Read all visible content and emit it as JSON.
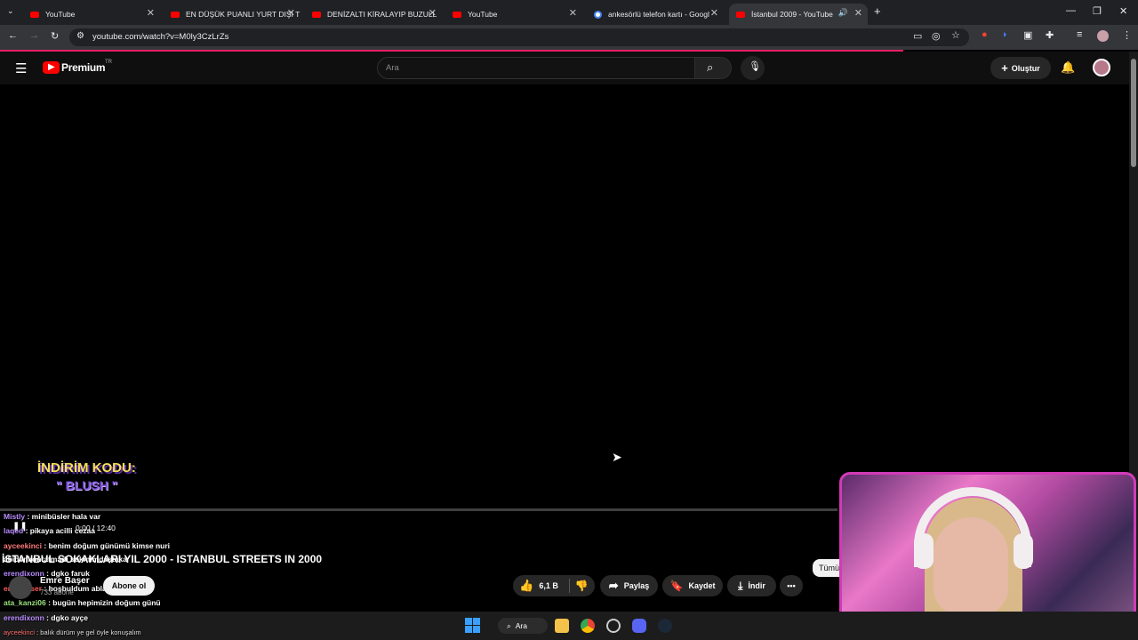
{
  "browser": {
    "tabs": [
      {
        "label": "YouTube"
      },
      {
        "label": "EN DÜŞÜK PUANLI YURT DIŞI T"
      },
      {
        "label": "DENİZALTI KİRALAYIP BUZULL"
      },
      {
        "label": "YouTube"
      },
      {
        "label": "ankesörlü telefon kartı - Googl"
      },
      {
        "label": "İstanbul 2009 - YouTube"
      }
    ],
    "url": "youtube.com/watch?v=M0ly3CzLrZs",
    "new_tab": "+"
  },
  "youtube": {
    "logo": "Premium",
    "region": "TR",
    "search_placeholder": "Ara",
    "create_label": "Oluştur"
  },
  "overlay": {
    "promo_line1": "İNDİRİM KODU:",
    "promo_line2": "\" BLUSH \"",
    "time": "0:00 / 12:40"
  },
  "chat": [
    {
      "user": "Mistly",
      "msg": " : minibüsler hala var"
    },
    {
      "user": "laqed",
      "msg": " : pikaya acilli cezaa"
    },
    {
      "user": "ayceekinci",
      "msg": " : benim doğum günümü kimse nuri"
    },
    {
      "user": "abidenkontatmadı",
      "msg": " sokmimdaştaka"
    },
    {
      "user": "erendixonn",
      "msg": " : dgko faruk"
    },
    {
      "user": "emrebaser",
      "msg": " : hoşbuldum abla"
    },
    {
      "user": "ata_kanzi06",
      "msg": " : bugün hepimizin doğum günü"
    },
    {
      "user": "erendixonn",
      "msg": " : dgko ayçe"
    },
    {
      "user": "ayceekinci",
      "msg": " : balık dürüm ye gel öyle konuşalım"
    }
  ],
  "video": {
    "title": "İSTANBUL SOKAKLARI YIL 2000 - ISTANBUL STREETS IN 2000",
    "channel": "Emre Başer",
    "subscribers": "733 abone",
    "subscribe_label": "Abone ol",
    "likes": "6,1 B",
    "share_label": "Paylaş",
    "save_label": "Kaydet",
    "download_label": "İndir",
    "more_label": "•••",
    "filter_chip": "Tümü"
  },
  "taskbar": {
    "search_label": "Ara"
  },
  "colors": {
    "progress_accent": "#e91e63",
    "webcam_border": "#d13bb7",
    "youtube_red": "#ff0000"
  }
}
